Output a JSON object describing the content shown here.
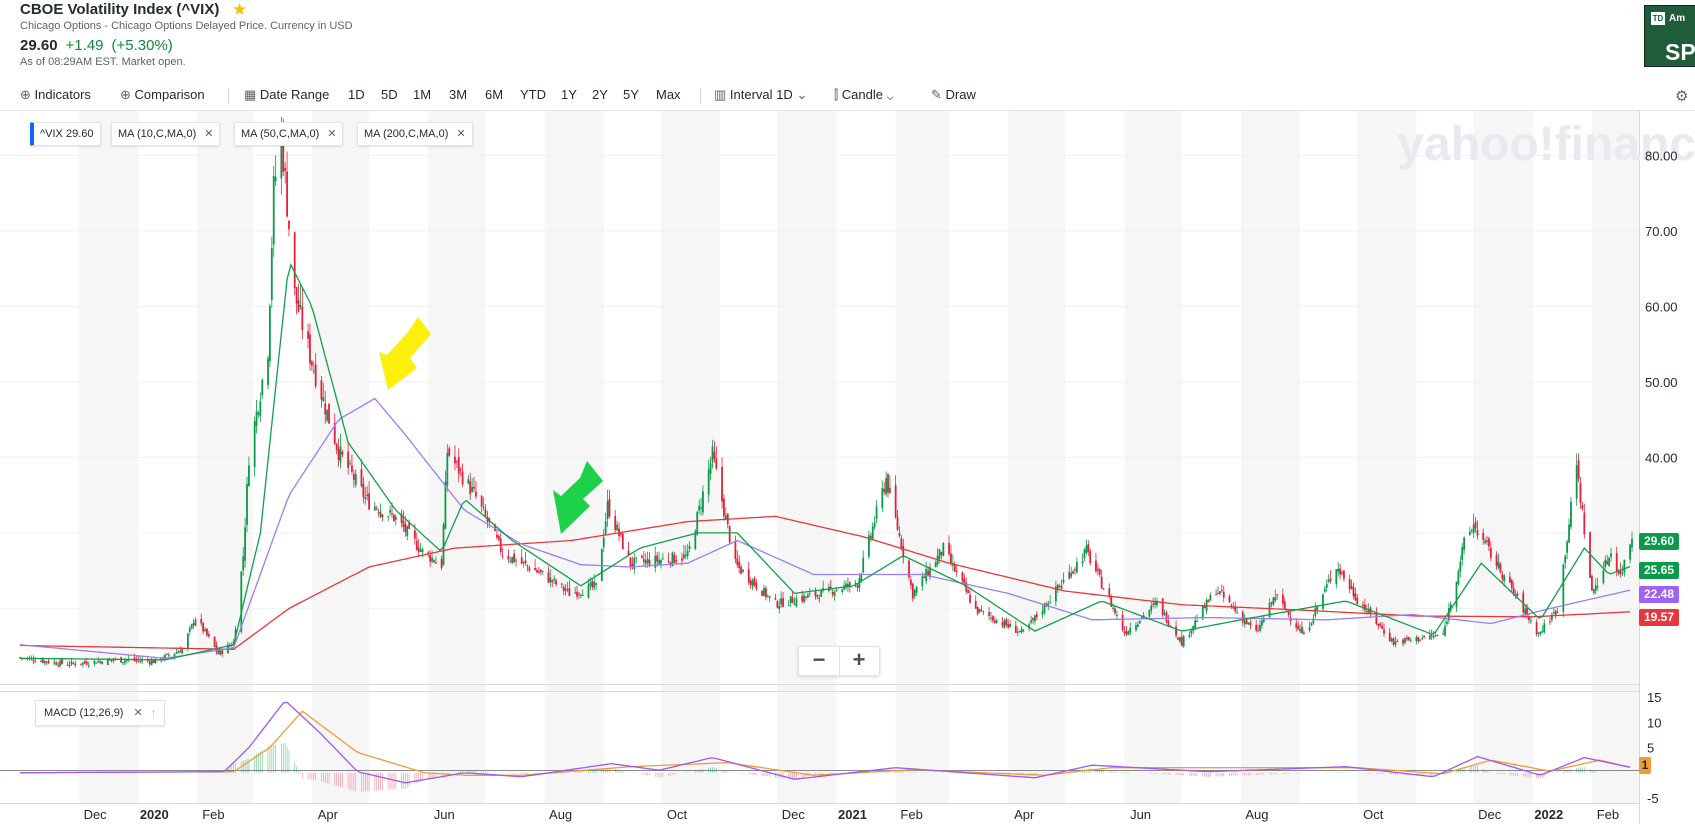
{
  "header": {
    "title": "CBOE Volatility Index (^VIX)",
    "subtitle": "Chicago Options - Chicago Options Delayed Price. Currency in USD",
    "price": "29.60",
    "change": "+1.49",
    "change_pct": "(+5.30%)",
    "as_of": "As of 08:29AM EST. Market open."
  },
  "ad": {
    "logo": "TD",
    "line1": "Am",
    "line2": "SP"
  },
  "toolbar": {
    "indicators": "Indicators",
    "comparison": "Comparison",
    "date_range": "Date Range",
    "ranges": [
      "1D",
      "5D",
      "1M",
      "3M",
      "6M",
      "YTD",
      "1Y",
      "2Y",
      "5Y",
      "Max"
    ],
    "interval_label": "Interval",
    "interval_value": "1D",
    "chart_type": "Candle",
    "draw": "Draw"
  },
  "legend": {
    "vix_label": "^VIX",
    "vix_value": "29.60",
    "ma10": "MA (10,C,MA,0)",
    "ma50": "MA (50,C,MA,0)",
    "ma200": "MA (200,C,MA,0)"
  },
  "watermark": "yahoo!finance",
  "price_badges": {
    "vix": "29.60",
    "ma10": "25.65",
    "ma50": "22.48",
    "ma200": "19.57",
    "macd": "1"
  },
  "macd_label": "MACD (12,26,9)",
  "colors": {
    "up": "#0a9a4a",
    "down": "#e0213b",
    "ma10": "#11a04a",
    "ma50": "#9b7ef3",
    "ma200": "#e8373b",
    "signal": "#f39c35",
    "macd": "#9b59f5"
  },
  "chart_data": {
    "type": "candlestick",
    "title": "CBOE Volatility Index (^VIX)",
    "y_ticks": [
      "80.00",
      "70.00",
      "60.00",
      "50.00",
      "40.00"
    ],
    "ylim": [
      10,
      86
    ],
    "macd_ticks": [
      "15",
      "10",
      "5",
      "1",
      "-5"
    ],
    "macd_ylim": [
      -6,
      16
    ],
    "x_labels": [
      {
        "label": "Dec",
        "bold": false
      },
      {
        "label": "2020",
        "bold": true
      },
      {
        "label": "Feb",
        "bold": false
      },
      {
        "label": "Apr",
        "bold": false
      },
      {
        "label": "Jun",
        "bold": false
      },
      {
        "label": "Aug",
        "bold": false
      },
      {
        "label": "Oct",
        "bold": false
      },
      {
        "label": "Dec",
        "bold": false
      },
      {
        "label": "2021",
        "bold": true
      },
      {
        "label": "Feb",
        "bold": false
      },
      {
        "label": "Apr",
        "bold": false
      },
      {
        "label": "Jun",
        "bold": false
      },
      {
        "label": "Aug",
        "bold": false
      },
      {
        "label": "Oct",
        "bold": false
      },
      {
        "label": "Dec",
        "bold": false
      },
      {
        "label": "2022",
        "bold": true
      },
      {
        "label": "Feb",
        "bold": false
      }
    ],
    "x_range": [
      "2019-10-31",
      "2022-02-22"
    ],
    "close_path": [
      [
        "2019-10-31",
        13.5
      ],
      [
        "2019-11-25",
        12.6
      ],
      [
        "2019-12-20",
        13.2
      ],
      [
        "2020-01-10",
        13.0
      ],
      [
        "2020-01-24",
        14.6
      ],
      [
        "2020-01-31",
        18.8
      ],
      [
        "2020-02-12",
        14.0
      ],
      [
        "2020-02-20",
        15.5
      ],
      [
        "2020-02-25",
        27.0
      ],
      [
        "2020-02-28",
        40.1
      ],
      [
        "2020-03-09",
        54.5
      ],
      [
        "2020-03-12",
        75.5
      ],
      [
        "2020-03-16",
        82.7
      ],
      [
        "2020-03-23",
        61.6
      ],
      [
        "2020-03-31",
        53.5
      ],
      [
        "2020-04-15",
        40.8
      ],
      [
        "2020-04-30",
        34.2
      ],
      [
        "2020-05-15",
        31.9
      ],
      [
        "2020-05-29",
        27.5
      ],
      [
        "2020-06-08",
        25.8
      ],
      [
        "2020-06-11",
        40.8
      ],
      [
        "2020-06-26",
        34.7
      ],
      [
        "2020-07-10",
        27.3
      ],
      [
        "2020-07-31",
        24.5
      ],
      [
        "2020-08-14",
        22.0
      ],
      [
        "2020-08-28",
        22.9
      ],
      [
        "2020-09-03",
        33.6
      ],
      [
        "2020-09-15",
        25.9
      ],
      [
        "2020-09-30",
        26.4
      ],
      [
        "2020-10-15",
        26.9
      ],
      [
        "2020-10-28",
        40.3
      ],
      [
        "2020-11-09",
        25.8
      ],
      [
        "2020-11-30",
        20.6
      ],
      [
        "2020-12-18",
        21.6
      ],
      [
        "2021-01-12",
        23.3
      ],
      [
        "2021-01-27",
        37.2
      ],
      [
        "2021-02-10",
        21.9
      ],
      [
        "2021-02-26",
        27.9
      ],
      [
        "2021-03-15",
        19.8
      ],
      [
        "2021-04-09",
        16.7
      ],
      [
        "2021-05-12",
        27.6
      ],
      [
        "2021-06-01",
        16.8
      ],
      [
        "2021-06-18",
        20.7
      ],
      [
        "2021-07-01",
        15.5
      ],
      [
        "2021-07-19",
        22.5
      ],
      [
        "2021-08-09",
        16.7
      ],
      [
        "2021-08-19",
        21.7
      ],
      [
        "2021-09-03",
        16.4
      ],
      [
        "2021-09-20",
        25.7
      ],
      [
        "2021-10-01",
        21.2
      ],
      [
        "2021-10-20",
        15.5
      ],
      [
        "2021-11-15",
        16.5
      ],
      [
        "2021-11-26",
        28.6
      ],
      [
        "2021-12-01",
        31.1
      ],
      [
        "2021-12-20",
        22.9
      ],
      [
        "2022-01-04",
        16.6
      ],
      [
        "2022-01-14",
        20.0
      ],
      [
        "2022-01-24",
        38.9
      ],
      [
        "2022-02-01",
        22.0
      ],
      [
        "2022-02-11",
        27.4
      ],
      [
        "2022-02-16",
        24.3
      ],
      [
        "2022-02-22",
        29.6
      ]
    ],
    "ma10_path": [
      [
        "2019-10-31",
        13.4
      ],
      [
        "2020-01-15",
        13.2
      ],
      [
        "2020-02-20",
        15.2
      ],
      [
        "2020-03-05",
        30.0
      ],
      [
        "2020-03-20",
        66.0
      ],
      [
        "2020-04-01",
        60.0
      ],
      [
        "2020-04-20",
        42.0
      ],
      [
        "2020-05-15",
        33.0
      ],
      [
        "2020-06-08",
        27.5
      ],
      [
        "2020-06-20",
        34.5
      ],
      [
        "2020-07-15",
        29.0
      ],
      [
        "2020-08-20",
        23.0
      ],
      [
        "2020-09-20",
        28.0
      ],
      [
        "2020-10-20",
        30.0
      ],
      [
        "2020-11-10",
        30.0
      ],
      [
        "2020-12-10",
        22.0
      ],
      [
        "2021-01-10",
        23.0
      ],
      [
        "2021-02-05",
        27.0
      ],
      [
        "2021-03-10",
        23.0
      ],
      [
        "2021-04-15",
        17.0
      ],
      [
        "2021-05-20",
        21.0
      ],
      [
        "2021-07-01",
        17.0
      ],
      [
        "2021-08-01",
        18.5
      ],
      [
        "2021-09-25",
        21.0
      ],
      [
        "2021-11-10",
        16.5
      ],
      [
        "2021-12-05",
        26.0
      ],
      [
        "2022-01-05",
        18.5
      ],
      [
        "2022-01-28",
        28.0
      ],
      [
        "2022-02-10",
        24.5
      ],
      [
        "2022-02-22",
        25.65
      ]
    ],
    "ma50_path": [
      [
        "2019-10-31",
        15.2
      ],
      [
        "2020-01-15",
        13.4
      ],
      [
        "2020-02-20",
        14.8
      ],
      [
        "2020-03-20",
        35.0
      ],
      [
        "2020-04-15",
        45.0
      ],
      [
        "2020-05-04",
        47.8
      ],
      [
        "2020-05-20",
        43.0
      ],
      [
        "2020-06-20",
        33.0
      ],
      [
        "2020-07-20",
        28.5
      ],
      [
        "2020-08-20",
        25.8
      ],
      [
        "2020-09-15",
        25.5
      ],
      [
        "2020-10-15",
        26.0
      ],
      [
        "2020-11-10",
        29.0
      ],
      [
        "2020-12-20",
        24.5
      ],
      [
        "2021-02-15",
        24.5
      ],
      [
        "2021-04-01",
        22.0
      ],
      [
        "2021-05-15",
        18.5
      ],
      [
        "2021-07-15",
        18.8
      ],
      [
        "2021-09-15",
        18.5
      ],
      [
        "2021-10-30",
        19.2
      ],
      [
        "2021-12-10",
        18.0
      ],
      [
        "2022-01-10",
        20.0
      ],
      [
        "2022-02-22",
        22.48
      ]
    ],
    "ma200_path": [
      [
        "2019-10-31",
        15.1
      ],
      [
        "2020-02-20",
        14.6
      ],
      [
        "2020-03-20",
        20.0
      ],
      [
        "2020-05-01",
        25.5
      ],
      [
        "2020-06-15",
        28.0
      ],
      [
        "2020-08-15",
        29.0
      ],
      [
        "2020-10-15",
        31.5
      ],
      [
        "2020-11-30",
        32.2
      ],
      [
        "2021-01-15",
        29.5
      ],
      [
        "2021-03-01",
        26.0
      ],
      [
        "2021-05-01",
        22.3
      ],
      [
        "2021-07-01",
        20.5
      ],
      [
        "2021-09-01",
        19.8
      ],
      [
        "2021-11-01",
        19.0
      ],
      [
        "2022-01-01",
        18.9
      ],
      [
        "2022-02-22",
        19.57
      ]
    ],
    "macd_path": [
      [
        "2019-10-31",
        0.0
      ],
      [
        "2020-02-15",
        0.2
      ],
      [
        "2020-02-28",
        5.0
      ],
      [
        "2020-03-18",
        14.3
      ],
      [
        "2020-04-05",
        8.0
      ],
      [
        "2020-04-25",
        0.2
      ],
      [
        "2020-05-20",
        -2.0
      ],
      [
        "2020-06-20",
        0.0
      ],
      [
        "2020-07-20",
        -0.8
      ],
      [
        "2020-09-05",
        1.8
      ],
      [
        "2020-09-30",
        0.5
      ],
      [
        "2020-10-28",
        3.0
      ],
      [
        "2020-12-10",
        -1.3
      ],
      [
        "2021-02-01",
        1.0
      ],
      [
        "2021-04-15",
        -1.0
      ],
      [
        "2021-05-15",
        1.5
      ],
      [
        "2021-07-15",
        0.2
      ],
      [
        "2021-09-25",
        1.2
      ],
      [
        "2021-11-10",
        -0.8
      ],
      [
        "2021-12-03",
        3.2
      ],
      [
        "2022-01-05",
        -0.5
      ],
      [
        "2022-01-28",
        3.0
      ],
      [
        "2022-02-22",
        1.0
      ]
    ],
    "signal_path": [
      [
        "2019-10-31",
        0.0
      ],
      [
        "2020-02-20",
        0.2
      ],
      [
        "2020-03-10",
        5.0
      ],
      [
        "2020-03-27",
        12.2
      ],
      [
        "2020-04-25",
        4.0
      ],
      [
        "2020-05-30",
        0.0
      ],
      [
        "2020-06-20",
        -0.5
      ],
      [
        "2020-07-20",
        -0.5
      ],
      [
        "2020-09-15",
        1.2
      ],
      [
        "2020-11-05",
        2.0
      ],
      [
        "2020-12-20",
        -0.5
      ],
      [
        "2021-02-10",
        0.6
      ],
      [
        "2021-04-20",
        -0.5
      ],
      [
        "2021-05-25",
        1.0
      ],
      [
        "2021-10-01",
        1.0
      ],
      [
        "2021-11-15",
        -0.2
      ],
      [
        "2021-12-10",
        2.5
      ],
      [
        "2022-01-10",
        0.3
      ],
      [
        "2022-02-05",
        2.5
      ],
      [
        "2022-02-22",
        1.0
      ]
    ]
  }
}
